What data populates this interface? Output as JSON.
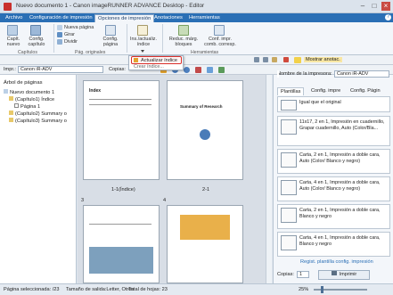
{
  "window": {
    "title": "Nuevo documento 1 - Canon imageRUNNER ADVANCE Desktop - Editor"
  },
  "tabs": [
    "Archivo",
    "Configuración de impresión",
    "Opciones de impresión",
    "Anotaciones",
    "Herramientas"
  ],
  "ribbon": {
    "capitulo": {
      "nuevo": "Capít. nuevo",
      "config": "Config. capítulo",
      "group": "Capítulos"
    },
    "pag_originales": {
      "nueva_pagina": "Nueva página",
      "girar": "Girar",
      "dividir": "Dividir",
      "config_pagina": "Config. página",
      "group": "Pág. originales"
    },
    "indice": {
      "label": "Ins./actualiz. índice"
    },
    "herramientas": {
      "reduc": "Reduc. márg. bloques",
      "conf_impr": "Conf. impr. comb. corresp.",
      "group": "Herramientas"
    }
  },
  "dropdown": {
    "item1": "Actualizar índice",
    "item2": "Crear índice..."
  },
  "toolbar": {
    "mostrar_anotac": "Mostrar anotac."
  },
  "printerbar": {
    "label": "Impr.:",
    "printer": "Canon iR-ADV",
    "copies_label": "Copias:",
    "copies": "1"
  },
  "leftpanel": {
    "title": "Árbol de páginas",
    "tree": [
      "Nuevo documento 1",
      "(Capítulo1) Índice",
      "Página 1",
      "(Capítulo2) Summary o",
      "(Capítulo3) Summary o"
    ]
  },
  "preview": {
    "page1_caption": "1-1(Índice)",
    "page2_caption": "2-1",
    "page3_num": "3",
    "page4_num": "4",
    "index_title": "Index",
    "summary_title": "Summary of Research"
  },
  "rightpanel": {
    "printer_label": "Nombre de la impresora:",
    "printer": "Canon iR-ADV",
    "tabs": [
      "Plantillas",
      "Config. impre",
      "Config. Págin"
    ],
    "cards": [
      "Igual que el original",
      "11x17, 2 en 1, Impresión en cuadernillo, Grapar cuadernillo, Auto (Color/Bla...",
      "Carta, 2 en 1, Impresión a doble cara, Auto (Color/ Blanco y negro)",
      "Carta, 4 en 1, Impresión a doble cara, Auto (Color/ Blanco y negro)",
      "Carta, 2 en 1, Impresión a doble cara, Blanco y negro",
      "Carta, 4 en 1, Impresión a doble cara, Blanco y negro"
    ],
    "regist": "Regist. plantilla config. impresión",
    "copies_label": "Copias:",
    "copies": "1",
    "print": "Imprimir"
  },
  "status": {
    "pages": "Página seleccionada: /23",
    "size": "Tamaño de salida:Letter, Otros",
    "total": "Total de hojas: 23",
    "zoom": "25%"
  },
  "colors": {
    "accent": "#2a6fb5",
    "highlight": "#d9302b"
  }
}
